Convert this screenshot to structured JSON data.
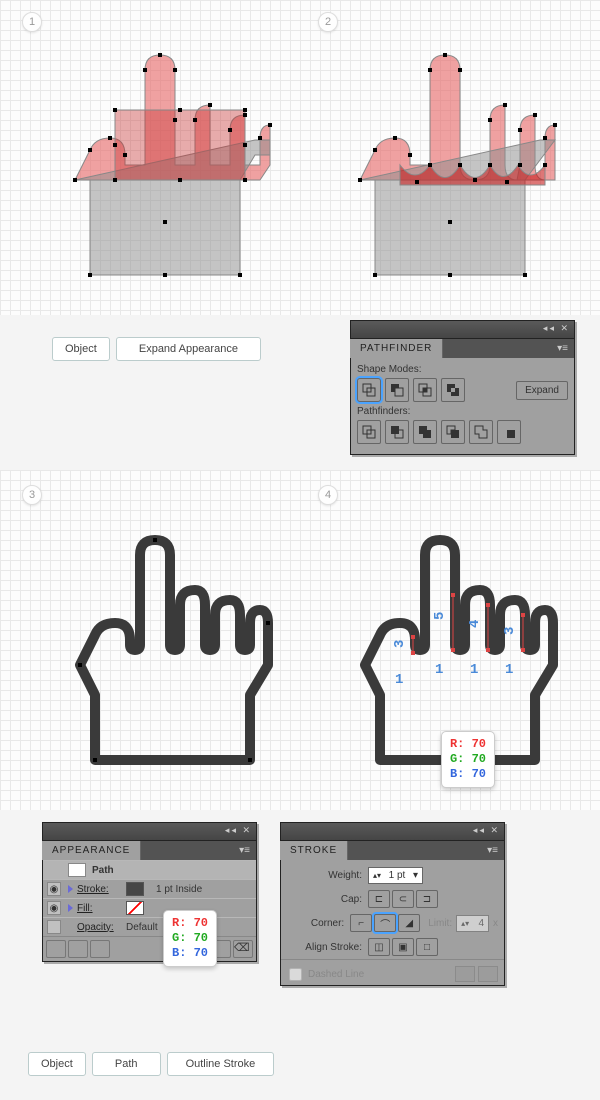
{
  "steps": {
    "s1": "1",
    "s2": "2",
    "s3": "3",
    "s4": "4"
  },
  "buttons": {
    "object": "Object",
    "expand_appearance": "Expand Appearance",
    "path": "Path",
    "outline_stroke": "Outline Stroke"
  },
  "pathfinder": {
    "title": "PATHFINDER",
    "shape_modes": "Shape Modes:",
    "pathfinders": "Pathfinders:",
    "expand": "Expand"
  },
  "appearance": {
    "title": "APPEARANCE",
    "path": "Path",
    "stroke": "Stroke:",
    "stroke_val": "1 pt  Inside",
    "fill": "Fill:",
    "opacity": "Opacity:",
    "opacity_val": "Default"
  },
  "stroke": {
    "title": "STROKE",
    "weight": "Weight:",
    "weight_val": "1 pt",
    "cap": "Cap:",
    "corner": "Corner:",
    "limit": "Limit:",
    "limit_val": "4",
    "x": "x",
    "align": "Align Stroke:",
    "dashed": "Dashed Line"
  },
  "color": {
    "r": "R: 70",
    "g": "G: 70",
    "b": "B: 70"
  },
  "annotations": {
    "n5": "5",
    "n4": "4",
    "n3a": "3",
    "n3b": "3",
    "n1a": "1",
    "n1b": "1",
    "n1c": "1",
    "n1d": "1"
  }
}
